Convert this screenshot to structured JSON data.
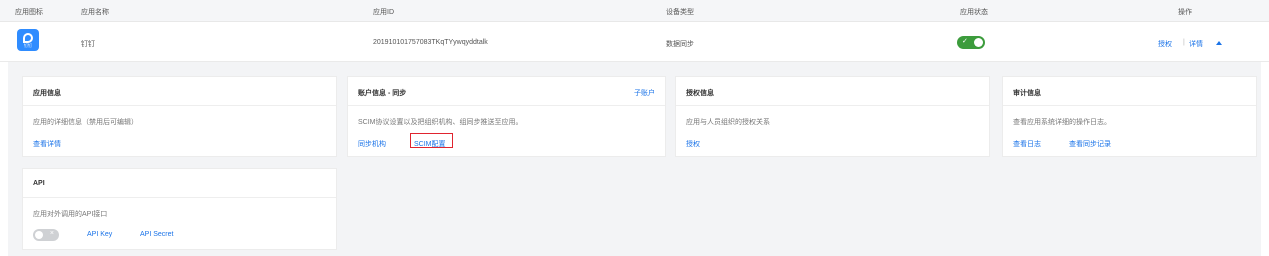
{
  "table": {
    "columns": {
      "icon": "应用图标",
      "name": "应用名称",
      "app_id": "应用ID",
      "device_type": "设备类型",
      "status": "应用状态",
      "actions": "操作"
    },
    "row": {
      "icon_label": "钉钉",
      "name": "钉钉",
      "app_id": "201910101757083TKqTYywqyddtalk",
      "device_type": "数据同步",
      "status_on": true,
      "action_authorize": "授权",
      "action_separator": "|",
      "action_details": "详情"
    }
  },
  "cards": {
    "app_info": {
      "title": "应用信息",
      "desc": "应用的详细信息（禁用后可编辑）",
      "link": "查看详情"
    },
    "account_sync": {
      "title": "账户信息 - 同步",
      "header_link": "子账户",
      "desc": "SCIM协议设置以及把组织机构、组同步推送至应用。",
      "link1": "同步机构",
      "link2": "SCIM配置"
    },
    "authorization": {
      "title": "授权信息",
      "desc": "应用与人员组织的授权关系",
      "link": "授权"
    },
    "audit": {
      "title": "审计信息",
      "desc": "查看应用系统详细的操作日志。",
      "link1": "查看日志",
      "link2": "查看同步记录"
    },
    "api": {
      "title": "API",
      "desc": "应用对外调用的API接口",
      "toggle_on": false,
      "link1": "API Key",
      "link2": "API Secret"
    }
  },
  "colors": {
    "accent": "#1a73e8",
    "toggle_on": "#3c9c3c",
    "highlight": "#e0242f"
  }
}
